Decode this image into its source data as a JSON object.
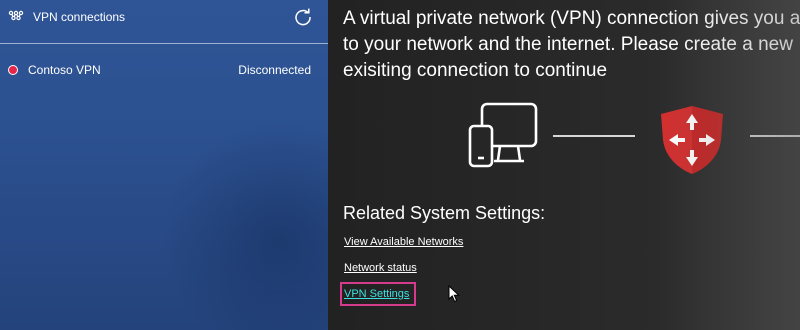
{
  "vpn_panel": {
    "title": "VPN connections",
    "title_icon": "vpn-network-icon",
    "refresh_icon": "refresh-icon",
    "connections": [
      {
        "name": "Contoso VPN",
        "status": "Disconnected",
        "status_color": "#e8254a"
      }
    ]
  },
  "main": {
    "intro_lines": [
      "A virtual private network (VPN) connection gives you a",
      "to your network and the internet. Please create a new",
      "exisiting connection to continue"
    ],
    "diagram": {
      "devices_icon": "devices-icon",
      "shield_icon": "vpn-shield-icon",
      "shield_color": "#d32f2f"
    },
    "related_heading": "Related System Settings:",
    "links": [
      {
        "label": "View Available Networks"
      },
      {
        "label": "Network status"
      },
      {
        "label": "VPN Settings",
        "focused": true
      }
    ]
  },
  "colors": {
    "left_panel_bg": "#2c5190",
    "right_panel_bg": "#262626",
    "focused_link": "#3ce0e0",
    "focus_outline": "#d63a8c"
  }
}
